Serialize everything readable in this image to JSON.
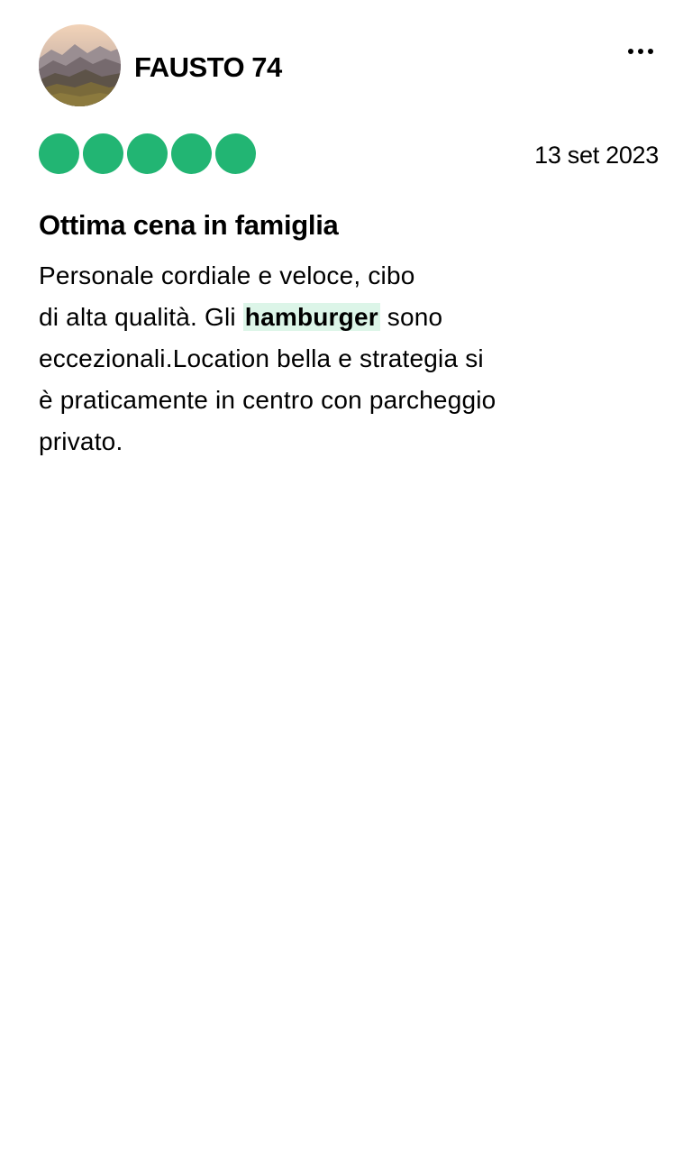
{
  "colors": {
    "rating_bubble": "#22b573",
    "highlight_bg": "#dcf5e8",
    "text": "#000000"
  },
  "header": {
    "avatar_icon": "mountain-landscape-avatar",
    "username": "FAUSTO 74",
    "more_icon": "more-horizontal-icon"
  },
  "rating": {
    "value": 5,
    "max": 5,
    "bubbles": [
      "filled",
      "filled",
      "filled",
      "filled",
      "filled"
    ]
  },
  "review": {
    "date": "13 set 2023",
    "title": "Ottima cena in famiglia",
    "body": {
      "line1": "Personale cordiale e veloce, cibo",
      "line2_before": "di alta qualità. Gli ",
      "line2_highlight": "hamburger",
      "line2_after": " sono",
      "line3": "eccezionali.Location bella e strategia si",
      "line4": "è praticamente in centro con parcheggio",
      "line5": "privato."
    }
  }
}
